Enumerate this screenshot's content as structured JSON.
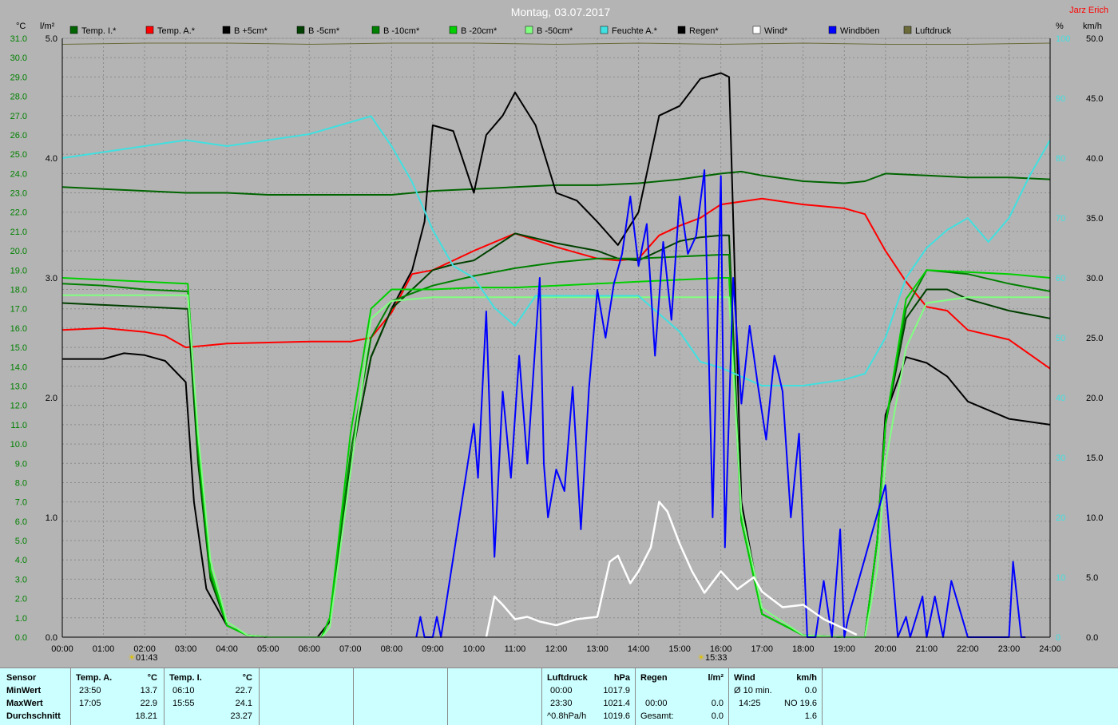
{
  "header": {
    "title": "Montag, 03.07.2017",
    "author": "Jarz Erich",
    "left_unit_c": "°C",
    "left_unit_l": "l/m²",
    "right_unit_pct": "%",
    "right_unit_kmh": "km/h"
  },
  "chart_data": {
    "type": "line",
    "x_range": [
      "00:00",
      "24:00"
    ],
    "x_ticks": [
      "00:00",
      "01:00",
      "02:00",
      "03:00",
      "04:00",
      "05:00",
      "06:00",
      "07:00",
      "08:00",
      "09:00",
      "10:00",
      "11:00",
      "12:00",
      "13:00",
      "14:00",
      "15:00",
      "16:00",
      "17:00",
      "18:00",
      "19:00",
      "20:00",
      "21:00",
      "22:00",
      "23:00",
      "24:00"
    ],
    "y_temp_range": [
      0,
      31
    ],
    "y_temp_ticks": [
      "0.0",
      "1.0",
      "2.0",
      "3.0",
      "4.0",
      "5.0",
      "6.0",
      "7.0",
      "8.0",
      "9.0",
      "10.0",
      "11.0",
      "12.0",
      "13.0",
      "14.0",
      "15.0",
      "16.0",
      "17.0",
      "18.0",
      "19.0",
      "20.0",
      "21.0",
      "22.0",
      "23.0",
      "24.0",
      "25.0",
      "26.0",
      "27.0",
      "28.0",
      "29.0",
      "30.0",
      "31.0"
    ],
    "y_rain_range": [
      0,
      5
    ],
    "y_rain_ticks": [
      "0.0",
      "1.0",
      "2.0",
      "3.0",
      "4.0",
      "5.0"
    ],
    "y_humidity_range": [
      0,
      100
    ],
    "y_humidity_ticks": [
      "0",
      "10",
      "20",
      "30",
      "40",
      "50",
      "60",
      "70",
      "80",
      "90",
      "100"
    ],
    "y_wind_range": [
      0,
      50
    ],
    "y_wind_ticks": [
      "0.0",
      "5.0",
      "10.0",
      "15.0",
      "20.0",
      "25.0",
      "30.0",
      "35.0",
      "40.0",
      "45.0",
      "50.0"
    ],
    "grid": true,
    "sunrise": "01:43",
    "sunset": "15:33",
    "legend": [
      {
        "name": "Temp. I.*",
        "color": "#006400"
      },
      {
        "name": "Temp. A.*",
        "color": "#ff0000"
      },
      {
        "name": "B +5cm*",
        "color": "#000000"
      },
      {
        "name": "B -5cm*",
        "color": "#004000"
      },
      {
        "name": "B -10cm*",
        "color": "#008000"
      },
      {
        "name": "B -20cm*",
        "color": "#00d000"
      },
      {
        "name": "B -50cm*",
        "color": "#80ff80"
      },
      {
        "name": "Feuchte A.*",
        "color": "#40e0e0"
      },
      {
        "name": "Regen*",
        "color": "#000000"
      },
      {
        "name": "Wind*",
        "color": "#ffffff"
      },
      {
        "name": "Windböen",
        "color": "#0000ff"
      },
      {
        "name": "Luftdruck",
        "color": "#6b6b3a"
      }
    ],
    "series": [
      {
        "name": "Temp. I.*",
        "axis": "temp",
        "color": "#006400",
        "x": [
          0,
          1,
          2,
          3,
          4,
          5,
          6,
          7,
          8,
          9,
          10,
          11,
          12,
          13,
          14,
          15,
          16,
          16.5,
          17,
          18,
          19,
          19.5,
          20,
          21,
          22,
          23,
          24
        ],
        "y": [
          23.3,
          23.2,
          23.1,
          23.0,
          23.0,
          22.9,
          22.9,
          22.9,
          22.9,
          23.1,
          23.2,
          23.3,
          23.4,
          23.4,
          23.5,
          23.7,
          24.0,
          24.1,
          23.9,
          23.6,
          23.5,
          23.6,
          24.0,
          23.9,
          23.8,
          23.8,
          23.7
        ]
      },
      {
        "name": "Temp. A.*",
        "axis": "temp",
        "color": "#ff0000",
        "x": [
          0,
          1,
          2,
          2.5,
          3,
          4,
          6,
          7,
          7.5,
          8,
          8.5,
          9,
          10,
          11,
          12,
          13,
          13.5,
          14,
          14.5,
          15,
          15.5,
          16,
          17,
          18,
          19,
          19.5,
          20,
          20.5,
          21,
          21.5,
          22,
          23,
          24
        ],
        "y": [
          15.9,
          16.0,
          15.8,
          15.6,
          15.0,
          15.2,
          15.3,
          15.3,
          15.5,
          16.8,
          18.8,
          19.0,
          20.0,
          20.9,
          20.2,
          19.6,
          19.5,
          19.6,
          20.8,
          21.3,
          21.7,
          22.4,
          22.7,
          22.4,
          22.2,
          21.9,
          20.0,
          18.4,
          17.1,
          16.9,
          15.9,
          15.4,
          13.9
        ]
      },
      {
        "name": "B +5cm*",
        "axis": "temp",
        "color": "#000000",
        "x": [
          0,
          1,
          1.5,
          2,
          2.5,
          3,
          3.2,
          3.5,
          4,
          4.5,
          5,
          6,
          6.2,
          6.5,
          7,
          7.5,
          8,
          8.5,
          8.8,
          9,
          9.5,
          10,
          10.3,
          10.7,
          11,
          11.5,
          12,
          12.5,
          13,
          13.5,
          14,
          14.5,
          15,
          15.5,
          16,
          16.2,
          16.5,
          17,
          18,
          19,
          19.3,
          19.5,
          19.8,
          20,
          20.5,
          21,
          21.5,
          22,
          23,
          24
        ],
        "y": [
          14.4,
          14.4,
          14.7,
          14.6,
          14.3,
          13.2,
          7.0,
          2.5,
          0.6,
          0.1,
          0.0,
          0.0,
          0.0,
          0.8,
          9.0,
          14.5,
          17.0,
          19.0,
          21.5,
          26.5,
          26.2,
          23.0,
          26.0,
          27.0,
          28.2,
          26.5,
          23.0,
          22.6,
          21.5,
          20.3,
          22.0,
          27.0,
          27.5,
          28.9,
          29.2,
          29.0,
          7.0,
          1.2,
          0.1,
          0.0,
          0.0,
          0.0,
          5.0,
          11.5,
          14.5,
          14.2,
          13.5,
          12.2,
          11.3,
          11.0
        ]
      },
      {
        "name": "B -5cm*",
        "axis": "temp",
        "color": "#004000",
        "x": [
          0,
          1,
          2,
          3,
          3.05,
          3.3,
          3.6,
          4,
          4.5,
          5,
          6.3,
          6.5,
          7,
          7.5,
          8,
          8.5,
          9,
          9.5,
          10,
          11,
          12,
          13,
          13.5,
          14,
          14.5,
          15,
          15.5,
          16,
          16.2,
          16.5,
          17,
          18,
          19,
          19.5,
          19.8,
          20,
          20.5,
          21,
          21.5,
          22,
          23,
          24
        ],
        "y": [
          17.3,
          17.2,
          17.1,
          17.0,
          17.0,
          9.0,
          3.0,
          0.6,
          0.1,
          0.0,
          0.0,
          1.0,
          9.0,
          14.5,
          17.0,
          18.0,
          19.0,
          19.3,
          19.5,
          20.9,
          20.4,
          20.0,
          19.6,
          19.5,
          20.0,
          20.5,
          20.7,
          20.8,
          20.8,
          6.0,
          1.2,
          0.1,
          0.0,
          0.0,
          5.0,
          11.0,
          16.5,
          18.0,
          18.0,
          17.5,
          16.9,
          16.5
        ]
      },
      {
        "name": "B -10cm*",
        "axis": "temp",
        "color": "#008000",
        "x": [
          0,
          1,
          2,
          3,
          3.05,
          3.3,
          3.6,
          4,
          4.5,
          5,
          6.3,
          6.5,
          7,
          7.5,
          8,
          9,
          10,
          11,
          12,
          13,
          14,
          15,
          16,
          16.2,
          16.5,
          17,
          18,
          19,
          19.5,
          19.8,
          20,
          20.5,
          21,
          22,
          23,
          24
        ],
        "y": [
          18.3,
          18.2,
          18.0,
          17.9,
          17.9,
          9.5,
          3.2,
          0.6,
          0.1,
          0.0,
          0.0,
          1.0,
          9.5,
          15.5,
          17.4,
          18.2,
          18.7,
          19.1,
          19.4,
          19.6,
          19.6,
          19.7,
          19.8,
          19.8,
          6.0,
          1.2,
          0.1,
          0.0,
          0.0,
          5.0,
          11.0,
          17.0,
          19.0,
          18.8,
          18.3,
          17.9
        ]
      },
      {
        "name": "B -20cm*",
        "axis": "temp",
        "color": "#00d000",
        "x": [
          0,
          1,
          2,
          3,
          3.05,
          3.3,
          3.6,
          4,
          4.5,
          5,
          6.3,
          6.5,
          7,
          7.5,
          8,
          9,
          10,
          11,
          12,
          13,
          14,
          15,
          16,
          16.2,
          16.5,
          17,
          18,
          19,
          19.5,
          19.8,
          20,
          20.5,
          21,
          22,
          23,
          24
        ],
        "y": [
          18.6,
          18.5,
          18.4,
          18.3,
          18.3,
          10.0,
          3.5,
          0.6,
          0.1,
          0.0,
          0.0,
          1.0,
          10.5,
          17.0,
          18.0,
          18.0,
          18.1,
          18.1,
          18.2,
          18.3,
          18.4,
          18.5,
          18.6,
          18.6,
          6.0,
          1.2,
          0.1,
          0.0,
          0.0,
          5.0,
          11.0,
          17.5,
          19.0,
          18.9,
          18.8,
          18.6
        ]
      },
      {
        "name": "B -50cm*",
        "axis": "temp",
        "color": "#80ff80",
        "x": [
          0,
          1,
          2,
          3,
          3.05,
          3.3,
          3.6,
          4,
          4.5,
          5,
          6.3,
          6.5,
          7,
          7.5,
          8,
          9,
          10,
          11,
          12,
          13,
          14,
          15,
          16,
          16.2,
          16.5,
          17,
          18,
          19,
          19.5,
          19.8,
          20,
          20.5,
          21,
          22,
          23,
          24
        ],
        "y": [
          17.7,
          17.7,
          17.7,
          17.7,
          17.7,
          10.5,
          4.0,
          0.8,
          0.1,
          0.0,
          0.0,
          0.5,
          8.5,
          16.5,
          17.4,
          17.6,
          17.6,
          17.6,
          17.6,
          17.6,
          17.6,
          17.6,
          17.6,
          17.6,
          6.5,
          1.5,
          0.1,
          0.0,
          0.0,
          3.5,
          9.0,
          15.0,
          17.3,
          17.6,
          17.6,
          17.6
        ]
      },
      {
        "name": "Feuchte A.*",
        "axis": "humidity",
        "color": "#40e0e0",
        "x": [
          0,
          1,
          2,
          3,
          4,
          5,
          6,
          7,
          7.5,
          8,
          8.5,
          9,
          9.5,
          10,
          10.5,
          11,
          11.5,
          12,
          13,
          14,
          15,
          15.5,
          16,
          17,
          18,
          19,
          19.5,
          20,
          20.5,
          21,
          21.5,
          22,
          22.5,
          23,
          23.5,
          24
        ],
        "y": [
          80,
          81,
          82,
          83,
          82,
          83,
          84,
          86,
          87,
          82,
          76,
          68,
          62,
          60,
          55,
          52,
          57,
          57,
          57,
          57,
          51,
          46,
          45,
          42,
          42,
          43,
          44,
          50,
          60,
          65,
          68,
          70,
          66,
          70,
          77,
          83
        ]
      },
      {
        "name": "Windböen",
        "axis": "wind",
        "color": "#0000ff",
        "x": [
          8.6,
          8.7,
          8.8,
          9.0,
          9.1,
          9.2,
          10.0,
          10.1,
          10.3,
          10.5,
          10.7,
          10.9,
          11.1,
          11.3,
          11.6,
          11.7,
          11.8,
          12.0,
          12.2,
          12.4,
          12.6,
          12.8,
          13.0,
          13.2,
          13.4,
          13.6,
          13.8,
          14.0,
          14.2,
          14.4,
          14.6,
          14.8,
          15.0,
          15.2,
          15.4,
          15.6,
          15.8,
          16.0,
          16.1,
          16.3,
          16.5,
          16.7,
          16.9,
          17.1,
          17.3,
          17.5,
          17.7,
          17.9,
          18.1,
          18.3,
          18.5,
          18.7,
          18.9,
          19.0,
          19.1,
          20.0,
          20.3,
          20.5,
          20.6,
          20.9,
          21.0,
          21.2,
          21.4,
          21.6,
          22.0,
          23.0,
          23.1,
          23.3,
          23.4
        ],
        "y": [
          0,
          1.7,
          0,
          0,
          1.7,
          0,
          17.8,
          13.3,
          27.2,
          6.7,
          20.5,
          13.3,
          23.5,
          14.5,
          30.0,
          14.5,
          10.0,
          14.0,
          12.2,
          20.9,
          9.0,
          20.9,
          29.0,
          25.0,
          29.5,
          32.0,
          36.8,
          31.0,
          34.5,
          23.5,
          33.0,
          26.5,
          36.8,
          32.0,
          33.5,
          39.0,
          10.0,
          38.5,
          7.5,
          30.0,
          19.5,
          26.0,
          21.0,
          16.5,
          23.5,
          20.5,
          10.0,
          17.0,
          0,
          0,
          4.7,
          0,
          9.0,
          0,
          1.7,
          12.7,
          0,
          1.7,
          0,
          3.4,
          0,
          3.4,
          0,
          4.7,
          0,
          0,
          6.3,
          0,
          0
        ]
      },
      {
        "name": "Wind*",
        "axis": "wind",
        "color": "#ffffff",
        "x": [
          10.3,
          10.5,
          10.7,
          11.0,
          11.3,
          11.6,
          12.0,
          12.5,
          13.0,
          13.3,
          13.5,
          13.8,
          14.0,
          14.3,
          14.5,
          14.7,
          15.0,
          15.3,
          15.6,
          16.0,
          16.4,
          16.8,
          17.0,
          17.5,
          18.0,
          18.5,
          19.0,
          19.3
        ],
        "y": [
          0,
          3.4,
          2.7,
          1.5,
          1.7,
          1.3,
          1.0,
          1.5,
          1.7,
          6.3,
          6.8,
          4.5,
          5.5,
          7.5,
          11.3,
          10.5,
          7.8,
          5.5,
          3.7,
          5.5,
          4.0,
          5.0,
          3.8,
          2.5,
          2.7,
          1.5,
          0.7,
          0.2
        ]
      },
      {
        "name": "Luftdruck",
        "axis": "top",
        "color": "#6b6b3a",
        "x": [
          0,
          2,
          4,
          6,
          8,
          10,
          12,
          14,
          16,
          18,
          20,
          22,
          24
        ],
        "y": [
          49.5,
          49.6,
          49.6,
          49.5,
          49.6,
          49.6,
          49.5,
          49.6,
          49.5,
          49.6,
          49.5,
          49.5,
          49.6
        ]
      }
    ]
  },
  "stats": {
    "sensor": {
      "label": "Sensor",
      "rows": [
        "MinWert",
        "MaxWert",
        "Durchschnitt"
      ]
    },
    "temp_a": {
      "label": "Temp. A.",
      "unit": "°C",
      "min_time": "23:50",
      "min_val": "13.7",
      "max_time": "17:05",
      "max_val": "22.9",
      "avg": "18.21"
    },
    "temp_i": {
      "label": "Temp. I.",
      "unit": "°C",
      "min_time": "06:10",
      "min_val": "22.7",
      "max_time": "15:55",
      "max_val": "24.1",
      "avg": "23.27"
    },
    "pressure": {
      "label": "Luftdruck",
      "unit": "hPa",
      "r1_time": "00:00",
      "r1_val": "1017.9",
      "r2_time": "23:30",
      "r2_val": "1021.4",
      "r3_label": "^0.8hPa/h",
      "r3_val": "1019.6"
    },
    "rain": {
      "label": "Regen",
      "unit": "l/m²",
      "r2_time": "00:00",
      "r2_val": "0.0",
      "r3_label": "Gesamt:",
      "r3_val": "0.0"
    },
    "wind": {
      "label": "Wind",
      "unit": "km/h",
      "r1_label": "Ø 10 min.",
      "r1_val": "0.0",
      "r2_time": "14:25",
      "r2_val": "NO 19.6",
      "r3_val": "1.6"
    }
  }
}
